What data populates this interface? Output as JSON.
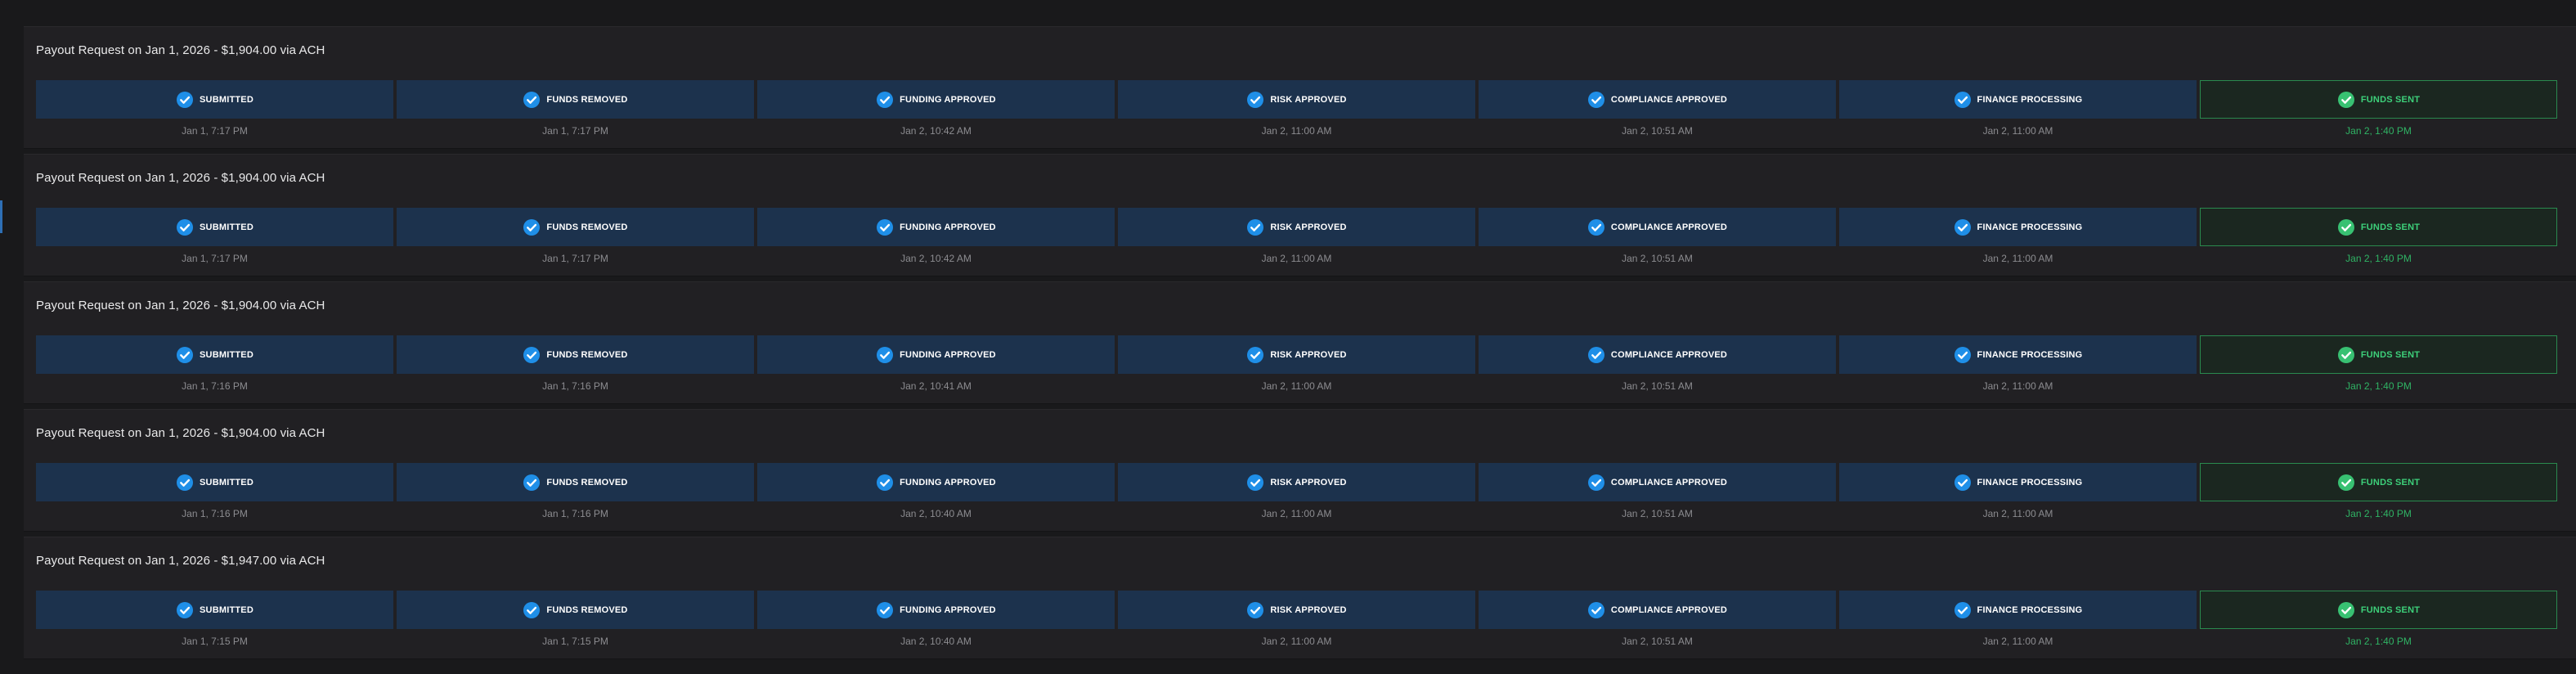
{
  "colors": {
    "page_background": "#19191b",
    "card_background": "#212023",
    "step_background": "#1c324d",
    "step_check": "#1f8fe8",
    "sent_border": "#2a8a4e",
    "sent_text": "#3dd07a"
  },
  "icons": {
    "step_check": "check-circle-icon"
  },
  "payouts": [
    {
      "title": "Payout Request on Jan 1, 2026 - $1,904.00 via ACH",
      "steps": [
        {
          "label": "SUBMITTED",
          "time": "Jan 1, 7:17 PM"
        },
        {
          "label": "FUNDS REMOVED",
          "time": "Jan 1, 7:17 PM"
        },
        {
          "label": "FUNDING APPROVED",
          "time": "Jan 2, 10:42 AM"
        },
        {
          "label": "RISK APPROVED",
          "time": "Jan 2, 11:00 AM"
        },
        {
          "label": "COMPLIANCE APPROVED",
          "time": "Jan 2, 10:51 AM"
        },
        {
          "label": "FINANCE PROCESSING",
          "time": "Jan 2, 11:00 AM"
        },
        {
          "label": "FUNDS SENT",
          "time": "Jan 2, 1:40 PM"
        }
      ]
    },
    {
      "title": "Payout Request on Jan 1, 2026 - $1,904.00 via ACH",
      "steps": [
        {
          "label": "SUBMITTED",
          "time": "Jan 1, 7:17 PM"
        },
        {
          "label": "FUNDS REMOVED",
          "time": "Jan 1, 7:17 PM"
        },
        {
          "label": "FUNDING APPROVED",
          "time": "Jan 2, 10:42 AM"
        },
        {
          "label": "RISK APPROVED",
          "time": "Jan 2, 11:00 AM"
        },
        {
          "label": "COMPLIANCE APPROVED",
          "time": "Jan 2, 10:51 AM"
        },
        {
          "label": "FINANCE PROCESSING",
          "time": "Jan 2, 11:00 AM"
        },
        {
          "label": "FUNDS SENT",
          "time": "Jan 2, 1:40 PM"
        }
      ]
    },
    {
      "title": "Payout Request on Jan 1, 2026 - $1,904.00 via ACH",
      "steps": [
        {
          "label": "SUBMITTED",
          "time": "Jan 1, 7:16 PM"
        },
        {
          "label": "FUNDS REMOVED",
          "time": "Jan 1, 7:16 PM"
        },
        {
          "label": "FUNDING APPROVED",
          "time": "Jan 2, 10:41 AM"
        },
        {
          "label": "RISK APPROVED",
          "time": "Jan 2, 11:00 AM"
        },
        {
          "label": "COMPLIANCE APPROVED",
          "time": "Jan 2, 10:51 AM"
        },
        {
          "label": "FINANCE PROCESSING",
          "time": "Jan 2, 11:00 AM"
        },
        {
          "label": "FUNDS SENT",
          "time": "Jan 2, 1:40 PM"
        }
      ]
    },
    {
      "title": "Payout Request on Jan 1, 2026 - $1,904.00 via ACH",
      "steps": [
        {
          "label": "SUBMITTED",
          "time": "Jan 1, 7:16 PM"
        },
        {
          "label": "FUNDS REMOVED",
          "time": "Jan 1, 7:16 PM"
        },
        {
          "label": "FUNDING APPROVED",
          "time": "Jan 2, 10:40 AM"
        },
        {
          "label": "RISK APPROVED",
          "time": "Jan 2, 11:00 AM"
        },
        {
          "label": "COMPLIANCE APPROVED",
          "time": "Jan 2, 10:51 AM"
        },
        {
          "label": "FINANCE PROCESSING",
          "time": "Jan 2, 11:00 AM"
        },
        {
          "label": "FUNDS SENT",
          "time": "Jan 2, 1:40 PM"
        }
      ]
    },
    {
      "title": "Payout Request on Jan 1, 2026 - $1,947.00 via ACH",
      "steps": [
        {
          "label": "SUBMITTED",
          "time": "Jan 1, 7:15 PM"
        },
        {
          "label": "FUNDS REMOVED",
          "time": "Jan 1, 7:15 PM"
        },
        {
          "label": "FUNDING APPROVED",
          "time": "Jan 2, 10:40 AM"
        },
        {
          "label": "RISK APPROVED",
          "time": "Jan 2, 11:00 AM"
        },
        {
          "label": "COMPLIANCE APPROVED",
          "time": "Jan 2, 10:51 AM"
        },
        {
          "label": "FINANCE PROCESSING",
          "time": "Jan 2, 11:00 AM"
        },
        {
          "label": "FUNDS SENT",
          "time": "Jan 2, 1:40 PM"
        }
      ]
    }
  ]
}
